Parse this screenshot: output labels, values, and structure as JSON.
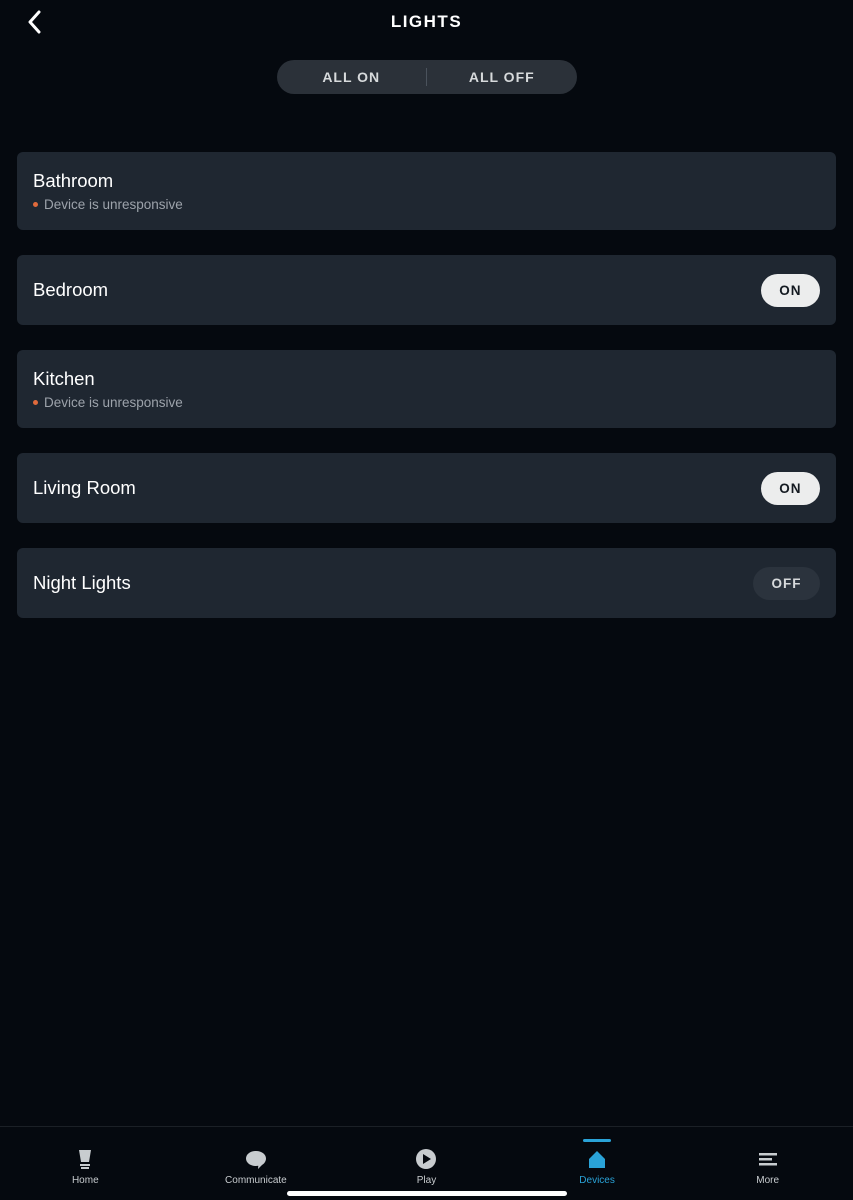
{
  "header": {
    "title": "LIGHTS"
  },
  "segmented": {
    "all_on": "ALL ON",
    "all_off": "ALL OFF"
  },
  "devices": [
    {
      "name": "Bathroom",
      "status": "Device is unresponsive",
      "toggle": null
    },
    {
      "name": "Bedroom",
      "status": null,
      "toggle": "ON"
    },
    {
      "name": "Kitchen",
      "status": "Device is unresponsive",
      "toggle": null
    },
    {
      "name": "Living Room",
      "status": null,
      "toggle": "ON"
    },
    {
      "name": "Night Lights",
      "status": null,
      "toggle": "OFF"
    }
  ],
  "tabs": {
    "home": "Home",
    "communicate": "Communicate",
    "play": "Play",
    "devices": "Devices",
    "more": "More"
  }
}
